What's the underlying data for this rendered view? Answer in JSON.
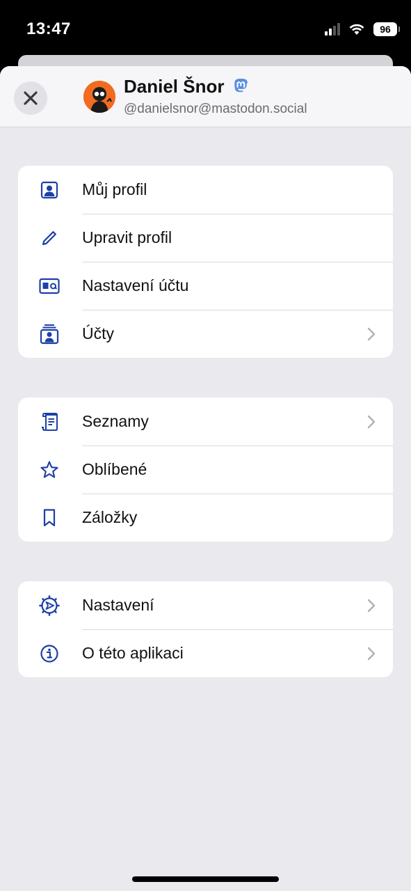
{
  "status_bar": {
    "time": "13:47",
    "battery": "96"
  },
  "profile": {
    "name": "Daniel Šnor",
    "handle": "@danielsnor@mastodon.social"
  },
  "menu_groups": [
    {
      "items": [
        {
          "label": "Můj profil",
          "icon": "person-icon",
          "chevron": false
        },
        {
          "label": "Upravit profil",
          "icon": "pencil-icon",
          "chevron": false
        },
        {
          "label": "Nastavení účtu",
          "icon": "account-card-icon",
          "chevron": false
        },
        {
          "label": "Účty",
          "icon": "accounts-stack-icon",
          "chevron": true
        }
      ]
    },
    {
      "items": [
        {
          "label": "Seznamy",
          "icon": "list-scroll-icon",
          "chevron": true
        },
        {
          "label": "Oblíbené",
          "icon": "star-icon",
          "chevron": false
        },
        {
          "label": "Záložky",
          "icon": "bookmark-icon",
          "chevron": false
        }
      ]
    },
    {
      "items": [
        {
          "label": "Nastavení",
          "icon": "gear-icon",
          "chevron": true
        },
        {
          "label": "O této aplikaci",
          "icon": "info-icon",
          "chevron": true
        }
      ]
    }
  ],
  "colors": {
    "accent": "#1d3fa6",
    "background": "#e9e9ee",
    "card": "#ffffff",
    "mastodon": "#5a8fe0",
    "avatar": "#f26b21"
  }
}
